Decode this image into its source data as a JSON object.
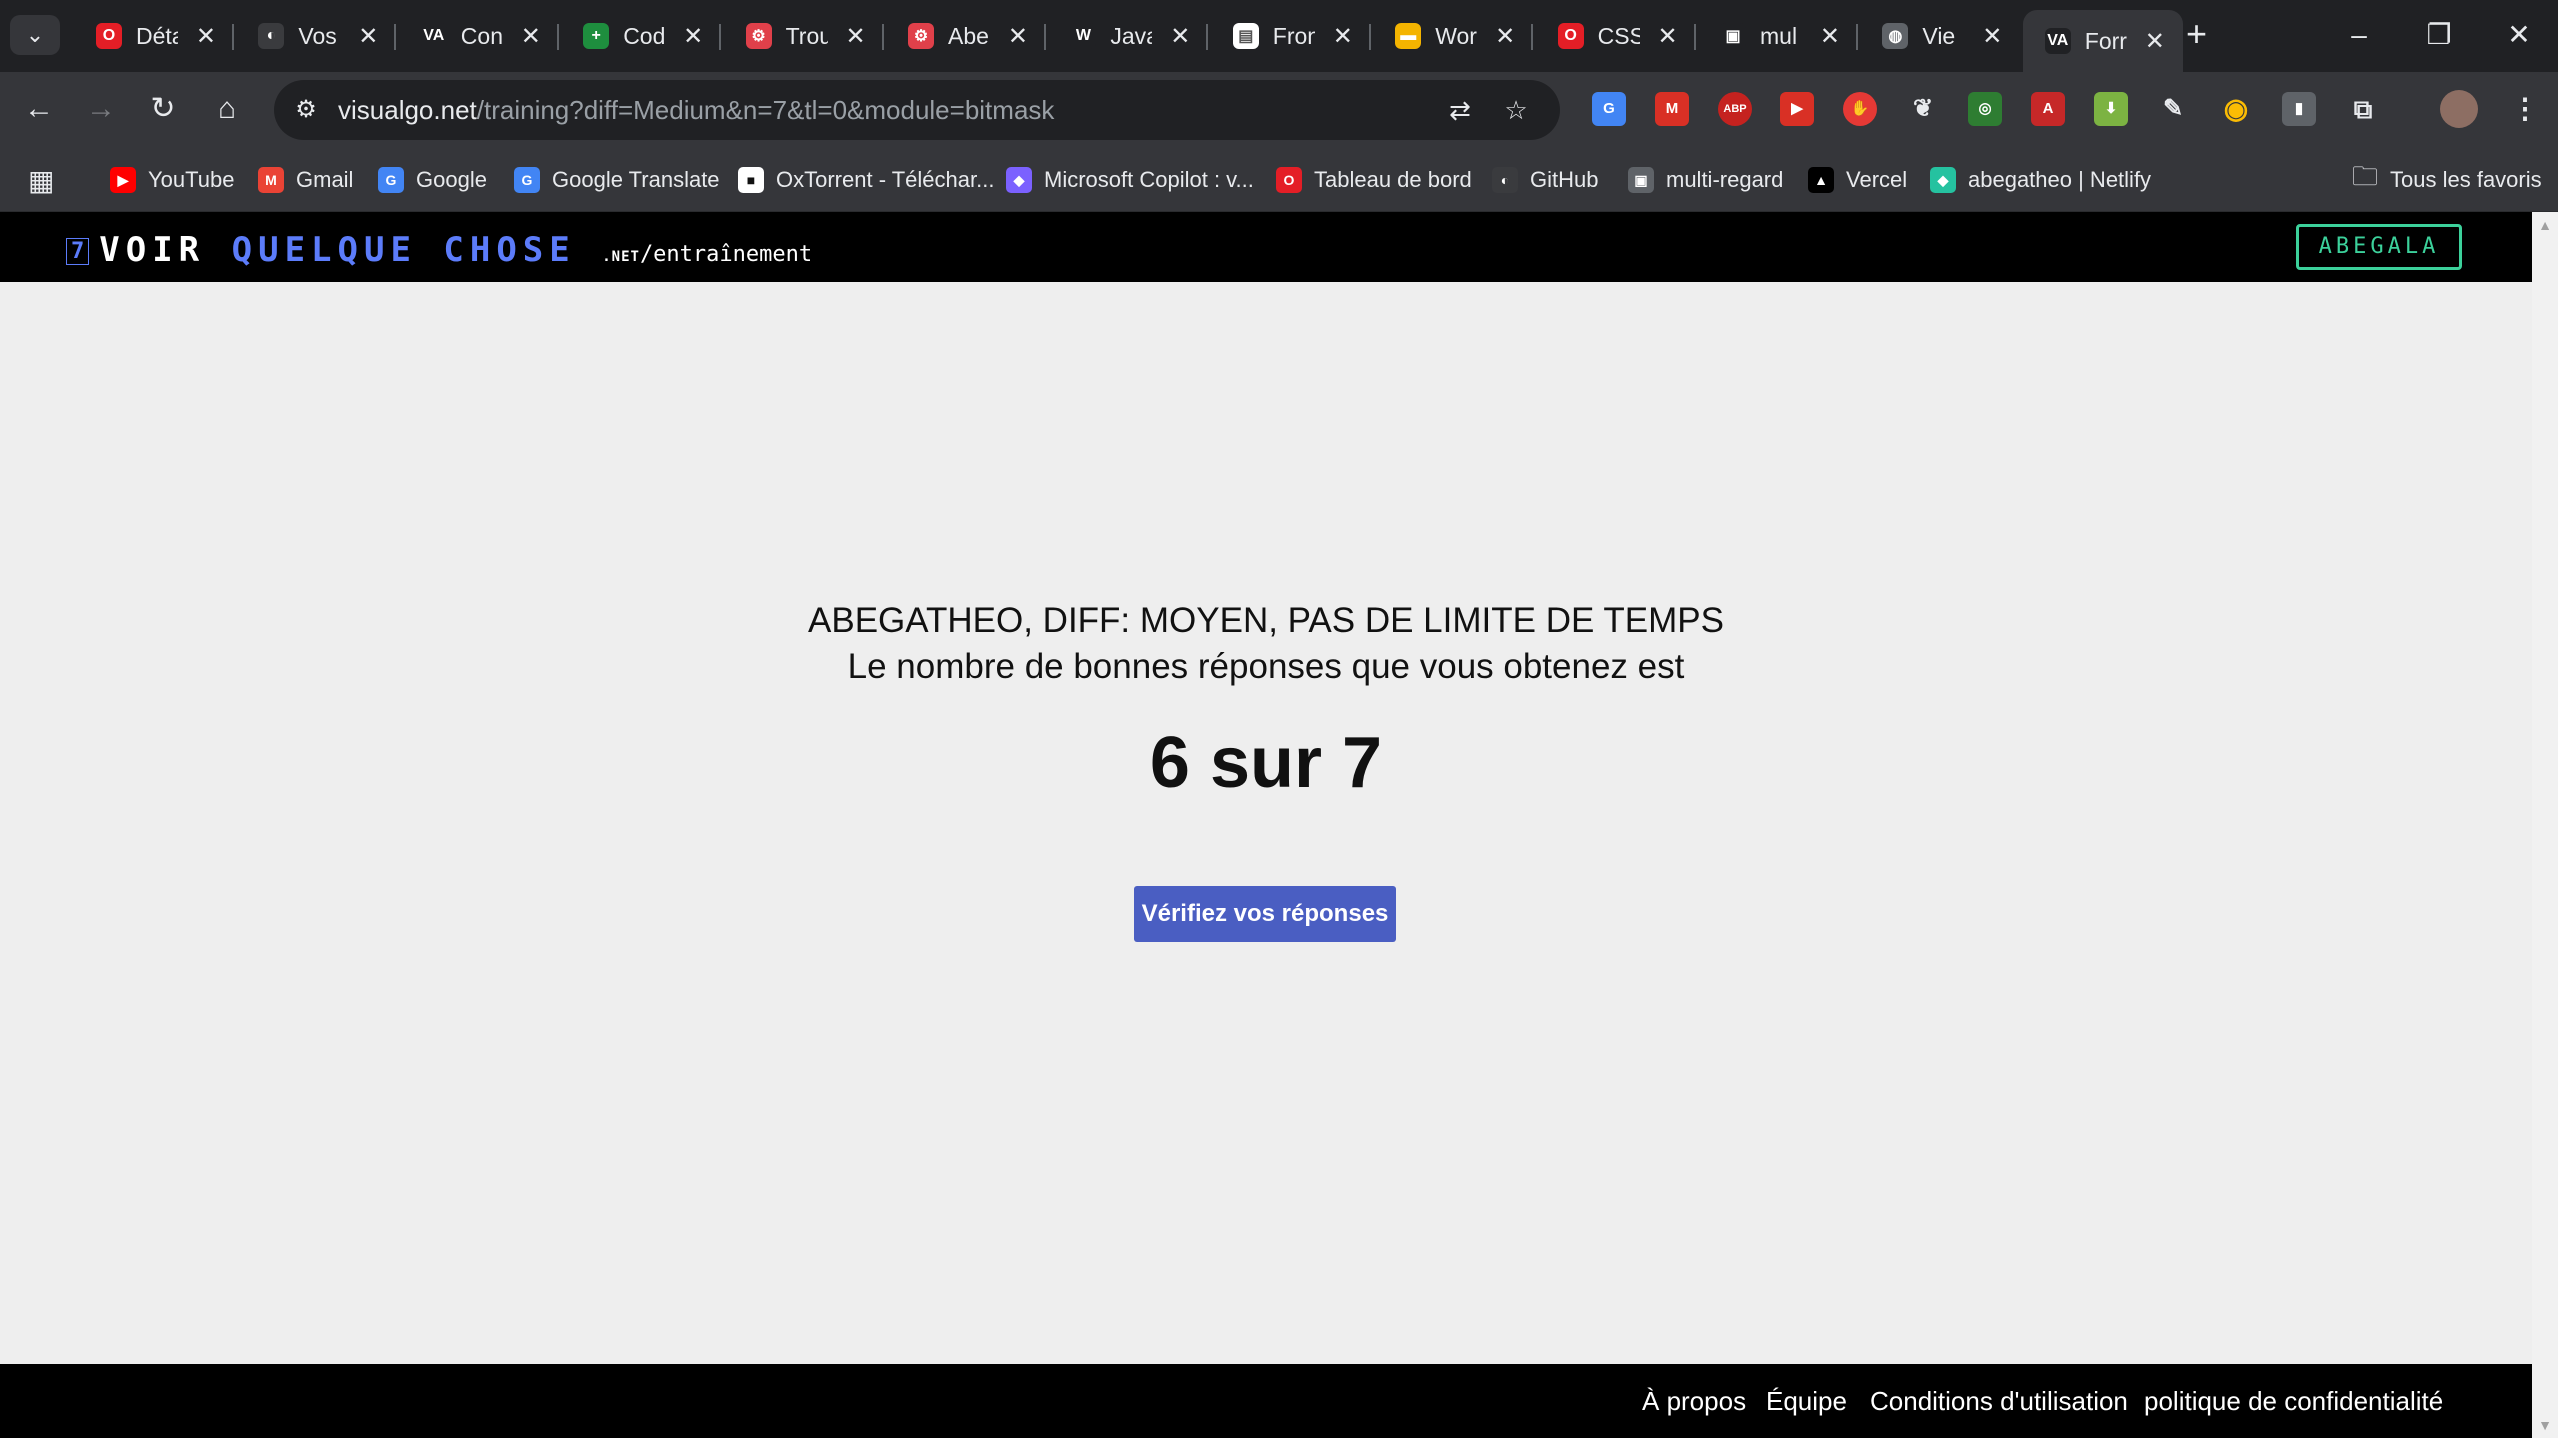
{
  "tabs": [
    {
      "title": "Déta",
      "favicon": "opera-icon",
      "color": "#e41e26"
    },
    {
      "title": "Vos",
      "favicon": "github-icon",
      "color": "#3a3b3e"
    },
    {
      "title": "Con",
      "favicon": "visualgo-icon",
      "color": "#202124"
    },
    {
      "title": "Cod",
      "favicon": "sheets-icon",
      "color": "#1e8e3e"
    },
    {
      "title": "Trou",
      "favicon": "chatgpt-icon",
      "color": "#e0404a"
    },
    {
      "title": "Abe",
      "favicon": "chatgpt-icon",
      "color": "#e0404a"
    },
    {
      "title": "Java",
      "favicon": "w-icon",
      "color": "#202124"
    },
    {
      "title": "Fron",
      "favicon": "page-icon",
      "color": "#ffffff"
    },
    {
      "title": "Wor",
      "favicon": "slides-icon",
      "color": "#f4b400"
    },
    {
      "title": "CSS",
      "favicon": "opera-icon",
      "color": "#e41e26"
    },
    {
      "title": "mul",
      "favicon": "doc-icon",
      "color": "#202124"
    },
    {
      "title": "Vie",
      "favicon": "globe-icon",
      "color": "#5f6368"
    },
    {
      "title": "Forr",
      "favicon": "visualgo-icon",
      "color": "#202124",
      "active": true
    }
  ],
  "address_bar": {
    "host": "visualgo.net",
    "path": "/training?diff=Medium&n=7&tl=0&module=bitmask"
  },
  "bookmarks": [
    {
      "label": "YouTube",
      "icon": "youtube-icon",
      "color": "#ff0000"
    },
    {
      "label": "Gmail",
      "icon": "gmail-icon",
      "color": "#ea4335"
    },
    {
      "label": "Google",
      "icon": "google-icon",
      "color": "#4285f4"
    },
    {
      "label": "Google Translate",
      "icon": "translate-icon",
      "color": "#4285f4"
    },
    {
      "label": "OxTorrent - Téléchar...",
      "icon": "oxtorrent-icon",
      "color": "#ffffff"
    },
    {
      "label": "Microsoft Copilot : v...",
      "icon": "copilot-icon",
      "color": "#7b61ff"
    },
    {
      "label": "Tableau de bord",
      "icon": "opera-icon",
      "color": "#e41e26"
    },
    {
      "label": "GitHub",
      "icon": "github-icon",
      "color": "#3a3b3e"
    },
    {
      "label": "multi-regard",
      "icon": "doc-icon",
      "color": "#5f6368"
    },
    {
      "label": "Vercel",
      "icon": "vercel-icon",
      "color": "#000000"
    },
    {
      "label": "abegatheo | Netlify",
      "icon": "netlify-icon",
      "color": "#25c2a0"
    }
  ],
  "all_bookmarks_label": "Tous les favoris",
  "site": {
    "logo_number": "7",
    "logo_word1": "VOIR",
    "logo_word2": "QUELQUE CHOSE",
    "logo_net": ".NET",
    "logo_path": "/entraînement",
    "user_button": "ABEGALA",
    "accent": "#5c7cfa",
    "user_color": "#3cd19b"
  },
  "result": {
    "line1": "ABEGATHEO, DIFF: MOYEN, PAS DE LIMITE DE TEMPS",
    "line2": "Le nombre de bonnes réponses que vous obtenez est",
    "score": "6 sur 7",
    "check_button": "Vérifiez vos réponses",
    "button_color": "#4a5ec2"
  },
  "footer": {
    "links": [
      "À propos",
      "Équipe",
      "Conditions d'utilisation",
      "politique de confidentialité"
    ]
  }
}
